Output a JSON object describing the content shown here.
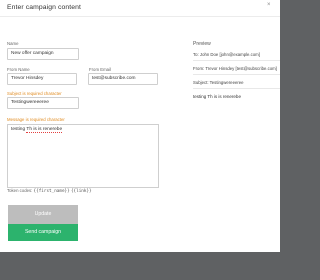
{
  "modal": {
    "title": "Enter campaign content",
    "close_icon": "×"
  },
  "form": {
    "name": {
      "label": "Name",
      "value": "New offer campaign"
    },
    "from_name": {
      "label": "From Name",
      "value": "Trevor Hinsdey"
    },
    "from_email": {
      "label": "From Email",
      "value": "test@subscribe.com"
    },
    "subject": {
      "label": "Subject is required character",
      "value": "Testingwereeeree"
    },
    "message": {
      "label": "Message is required character",
      "text_before": "testing ",
      "text_misspelled": "Th is is renerebe"
    },
    "tokens": {
      "label": "Token codes: ",
      "first": "{{first_name}}",
      "link": "{{link}}"
    }
  },
  "buttons": {
    "update": "Update",
    "send": "Send campaign"
  },
  "preview": {
    "label": "Preview",
    "to": "To: John Doe [john@example.com]",
    "from": "From: Trevor Hinsdey [test@subscribe.com]",
    "subject": "Subject: Testingwereeeree",
    "body": "testing Th is is renerebe"
  }
}
